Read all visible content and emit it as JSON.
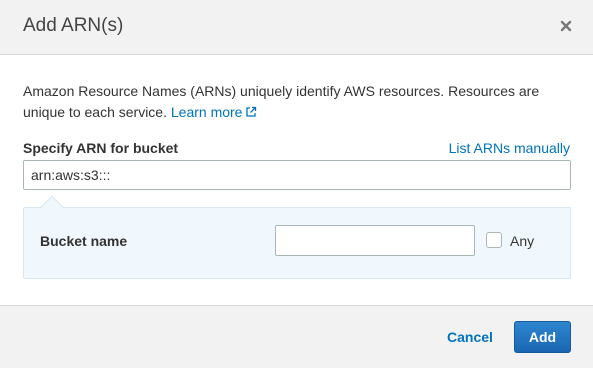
{
  "dialog": {
    "title": "Add ARN(s)",
    "close_icon": "close-icon"
  },
  "body": {
    "description": "Amazon Resource Names (ARNs) uniquely identify AWS resources. Resources are unique to each service.",
    "learn_more_label": "Learn more",
    "learn_more_icon": "external-link-icon",
    "arn_field": {
      "label": "Specify ARN for bucket",
      "list_manually_label": "List ARNs manually",
      "value": "arn:aws:s3:::"
    },
    "bucket": {
      "label": "Bucket name",
      "value": "",
      "any_label": "Any",
      "any_checked": false
    }
  },
  "footer": {
    "cancel_label": "Cancel",
    "add_label": "Add"
  },
  "colors": {
    "link": "#0073bb",
    "primary_button": "#1a66b2",
    "header_bg": "#f2f2f2",
    "panel_bg": "#f1f8fd"
  }
}
